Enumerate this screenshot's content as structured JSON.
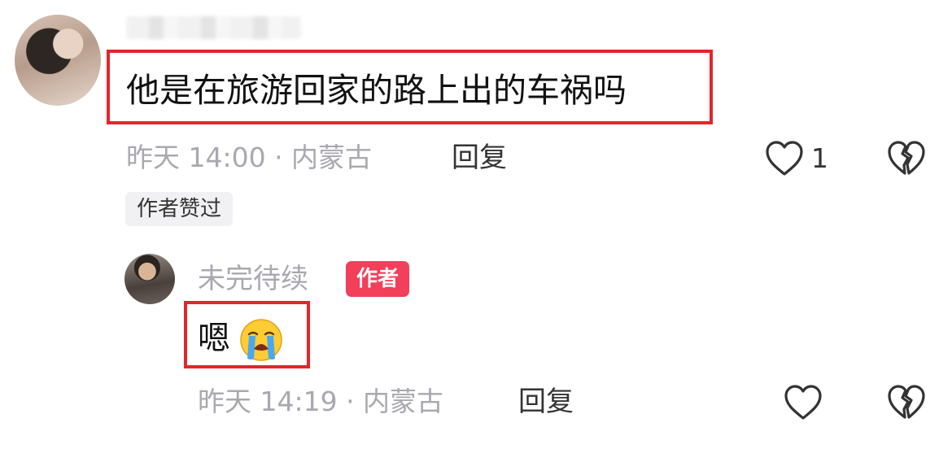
{
  "comments": [
    {
      "text": "他是在旅游回家的路上出的车祸吗",
      "meta": "昨天 14:00 · 内蒙古",
      "reply_label": "回复",
      "like_count": "1",
      "author_liked_label": "作者赞过",
      "like_icon": "heart-outline-icon",
      "dislike_icon": "broken-heart-icon"
    },
    {
      "username": "未完待续",
      "badge": "作者",
      "text": "嗯",
      "emoji": "loudly-crying-face",
      "meta": "昨天 14:19 · 内蒙古",
      "reply_label": "回复",
      "like_icon": "heart-outline-icon",
      "dislike_icon": "broken-heart-icon"
    }
  ],
  "colors": {
    "highlight_box": "#e2262b",
    "author_badge": "#f23f5a",
    "meta_text": "#a8a8b0"
  }
}
